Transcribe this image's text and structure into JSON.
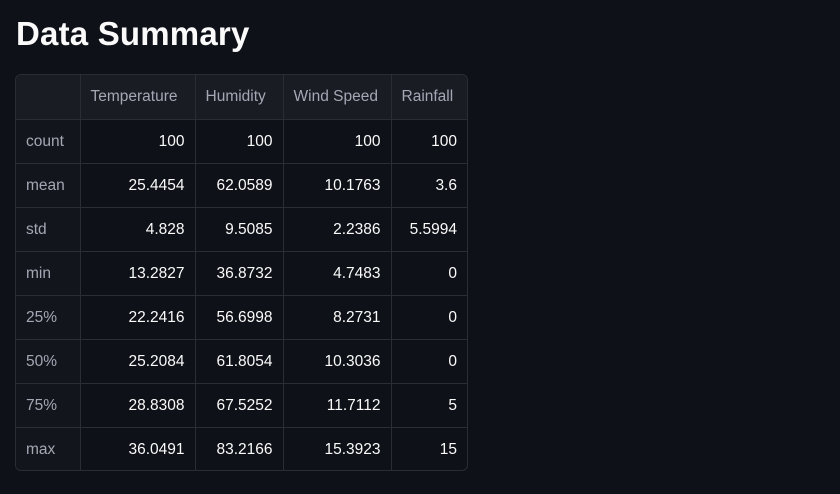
{
  "page": {
    "title": "Data Summary"
  },
  "summary_table": {
    "columns": [
      "",
      "Temperature",
      "Humidity",
      "Wind Speed",
      "Rainfall"
    ],
    "rows": [
      {
        "label": "count",
        "values": [
          "100",
          "100",
          "100",
          "100"
        ]
      },
      {
        "label": "mean",
        "values": [
          "25.4454",
          "62.0589",
          "10.1763",
          "3.6"
        ]
      },
      {
        "label": "std",
        "values": [
          "4.828",
          "9.5085",
          "2.2386",
          "5.5994"
        ]
      },
      {
        "label": "min",
        "values": [
          "13.2827",
          "36.8732",
          "4.7483",
          "0"
        ]
      },
      {
        "label": "25%",
        "values": [
          "22.2416",
          "56.6998",
          "8.2731",
          "0"
        ]
      },
      {
        "label": "50%",
        "values": [
          "25.2084",
          "61.8054",
          "10.3036",
          "0"
        ]
      },
      {
        "label": "75%",
        "values": [
          "28.8308",
          "67.5252",
          "11.7112",
          "5"
        ]
      },
      {
        "label": "max",
        "values": [
          "36.0491",
          "83.2166",
          "15.3923",
          "15"
        ]
      }
    ]
  },
  "colors": {
    "background": "#0e1117",
    "header_background": "#1a1c24",
    "border": "#2a2d36",
    "muted_text": "#a3a8b4",
    "text": "#fafafa"
  }
}
